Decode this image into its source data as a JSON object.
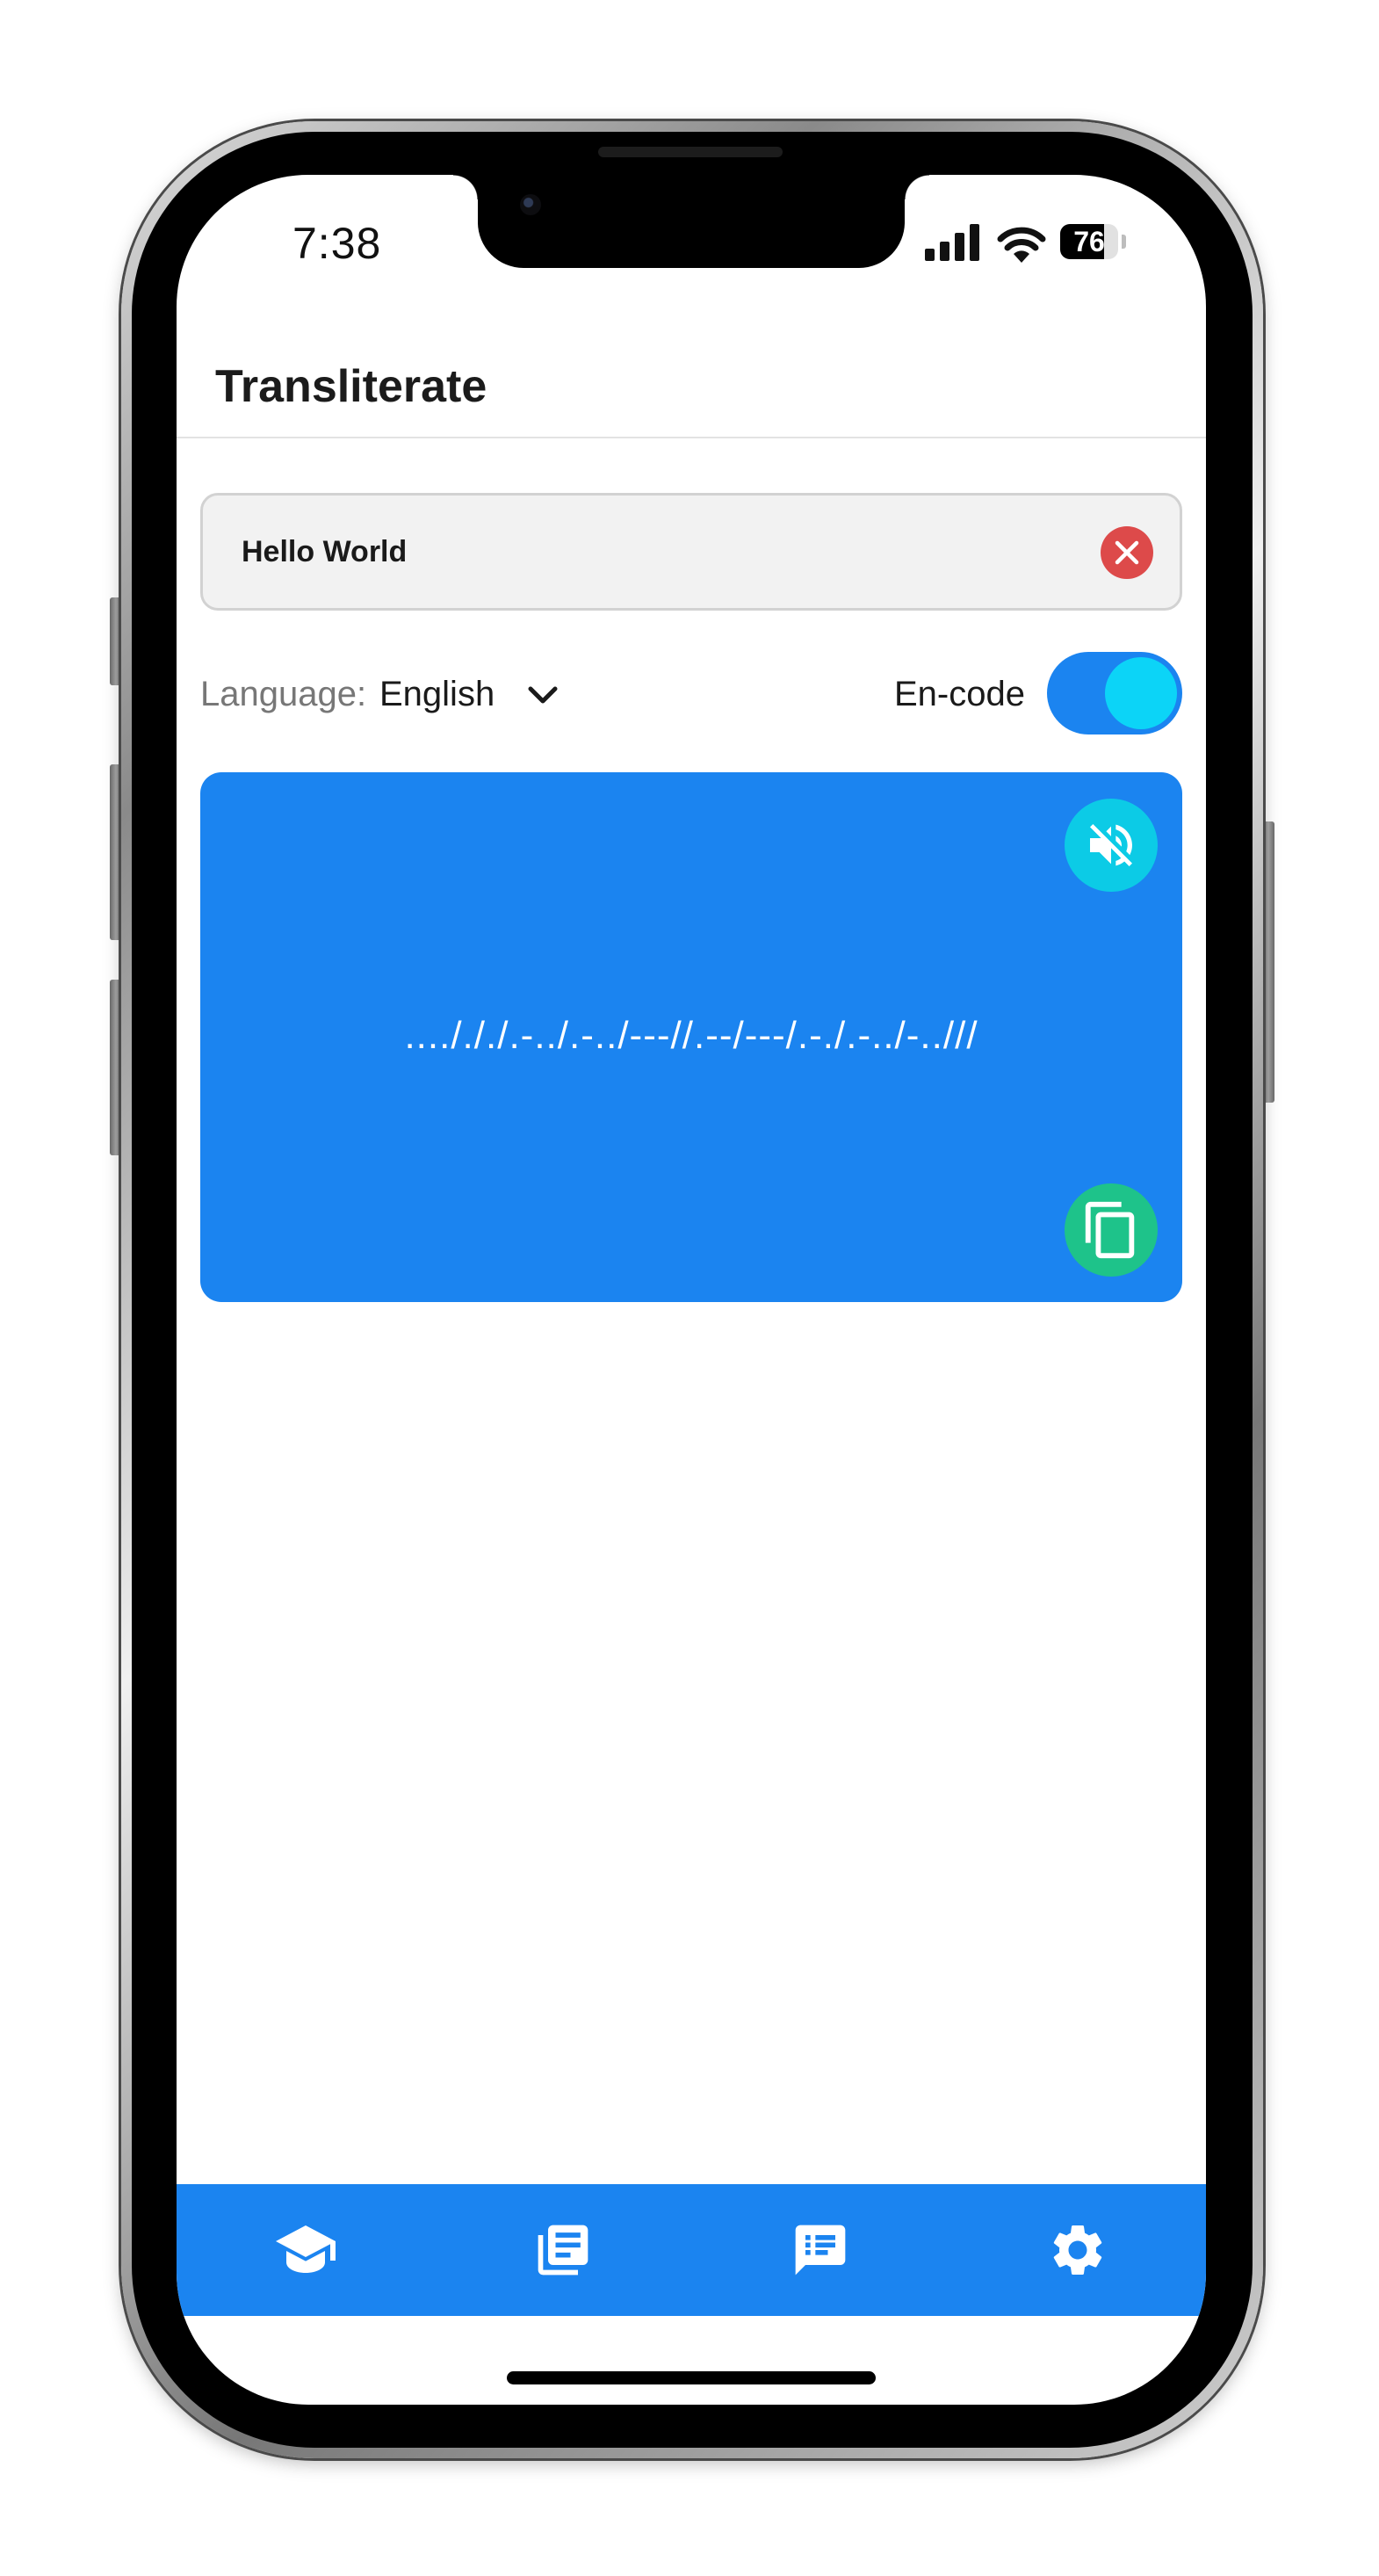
{
  "status_bar": {
    "time": "7:38",
    "battery_level": "76",
    "battery_fraction": 0.76,
    "signal_icon": "signal-bars-icon",
    "wifi_icon": "wifi-icon",
    "battery_icon": "battery-icon"
  },
  "header": {
    "title": "Transliterate"
  },
  "input": {
    "value": "Hello World",
    "clear_icon": "close-circle-icon"
  },
  "language": {
    "label": "Language:",
    "selected": "English",
    "dropdown_icon": "chevron-down-icon"
  },
  "encode_toggle": {
    "label": "En-code",
    "on": true
  },
  "output": {
    "text": "..../././.-../.-../---//.--/---/.-./.-../-..///",
    "mute_icon": "volume-off-icon",
    "copy_icon": "copy-icon"
  },
  "bottom_nav": {
    "items": [
      {
        "icon": "graduation-cap-icon"
      },
      {
        "icon": "newspaper-icon"
      },
      {
        "icon": "chat-list-icon"
      },
      {
        "icon": "gear-icon"
      }
    ]
  },
  "colors": {
    "primary": "#1b84f0",
    "toggle_knob": "#0cd4f7",
    "mute_button": "#0ccbe6",
    "copy_button": "#1ec38a",
    "clear_button": "#dd4a4a"
  }
}
